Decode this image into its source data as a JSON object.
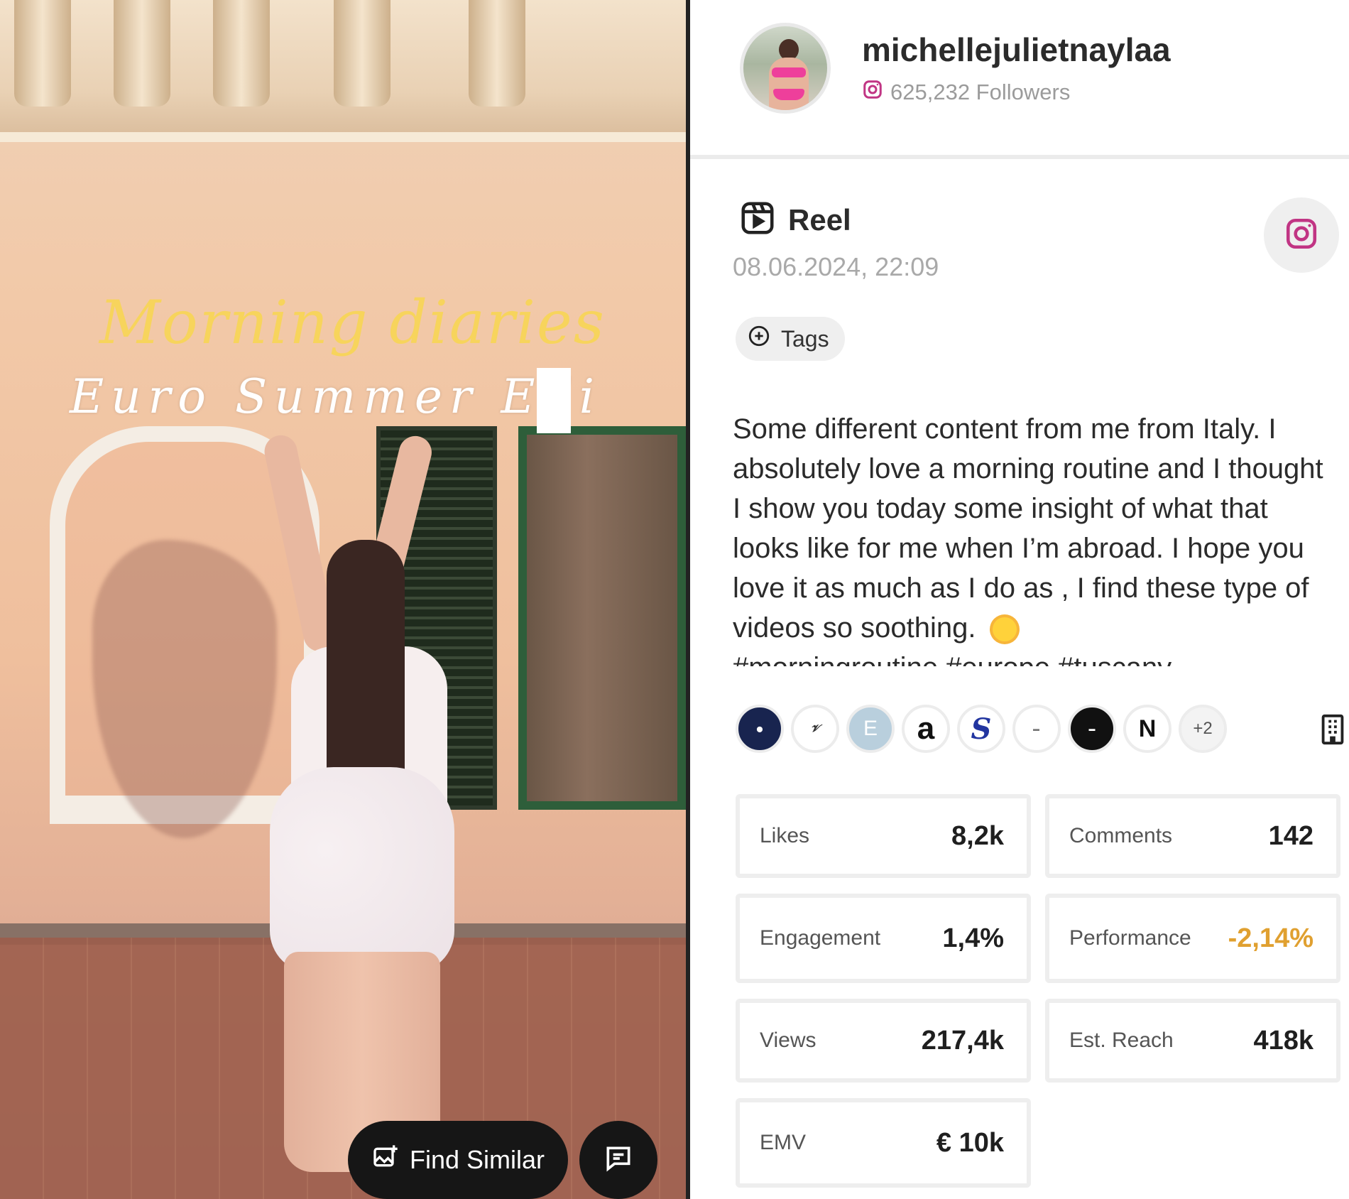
{
  "media": {
    "overlay_title": "Morning diaries",
    "overlay_subtitle": "Euro Summer Edi",
    "find_similar_label": "Find Similar"
  },
  "profile": {
    "username": "michellejulietnaylaa",
    "followers": "625,232 Followers"
  },
  "post": {
    "type": "Reel",
    "date": "08.06.2024, 22:09",
    "tags_label": "Tags",
    "caption": "Some different content from me from Italy. I absolutely love a morning routine and I thought I show you today some insight of what that looks like for me when I’m abroad. I hope you love it as much as I do as , I find these type of videos so soothing. ",
    "hashtags": "#morningroutine #europe #tuscany"
  },
  "brands": {
    "more_label": "+2"
  },
  "stats": {
    "likes": {
      "label": "Likes",
      "value": "8,2k"
    },
    "comments": {
      "label": "Comments",
      "value": "142"
    },
    "engagement": {
      "label": "Engagement",
      "value": "1,4%"
    },
    "performance": {
      "label": "Performance",
      "value": "-2,14%"
    },
    "views": {
      "label": "Views",
      "value": "217,4k"
    },
    "reach": {
      "label": "Est. Reach",
      "value": "418k"
    },
    "emv": {
      "label": "EMV",
      "value": "€ 10k"
    }
  },
  "colors": {
    "instagram_pink": "#c13584",
    "performance_negative": "#e0a030",
    "dark_button": "#161616"
  }
}
